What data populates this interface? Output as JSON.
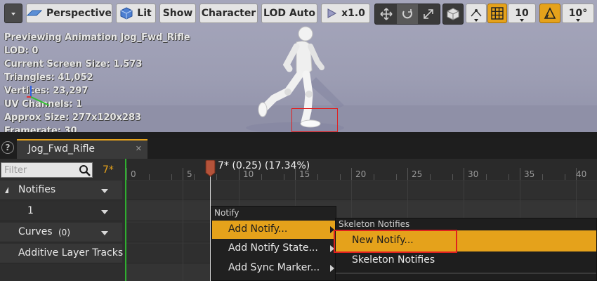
{
  "toolbar": {
    "perspective_label": "Perspective",
    "lit_label": "Lit",
    "show_label": "Show",
    "character_label": "Character",
    "lod_label": "LOD Auto",
    "speed_label": "x1.0",
    "grid_snap_value": "10",
    "rotation_snap_value": "10°"
  },
  "stats": [
    "Previewing Animation Jog_Fwd_Rifle",
    "LOD: 0",
    "Current Screen Size: 1.573",
    "Triangles: 41,052",
    "Vertices: 23,297",
    "UV Channels: 1",
    "Approx Size: 277x120x283",
    "Framerate: 30"
  ],
  "tab": {
    "title": "Jog_Fwd_Rifle"
  },
  "left_panel": {
    "filter_placeholder": "Filter",
    "frame_indicator": "7*",
    "tracks": {
      "notifies": "Notifies",
      "notify_row": "1",
      "curves": "Curves",
      "curves_count": "(0)",
      "additive": "Additive Layer Tracks"
    }
  },
  "timeline": {
    "ruler_labels": [
      "0",
      "5",
      "10",
      "15",
      "20",
      "25",
      "30",
      "35",
      "40"
    ],
    "scrubber_text": "7* (0.25) (17.34%)"
  },
  "context_menu": {
    "header": "Notify",
    "items": [
      "Add Notify...",
      "Add Notify State...",
      "Add Sync Marker..."
    ]
  },
  "submenu": {
    "header": "Skeleton Notifies",
    "items": [
      "New Notify...",
      "Skeleton Notifies"
    ]
  },
  "colors": {
    "accent": "#e5a21b",
    "highlight_red": "#e02020",
    "timeline_start": "#2fae2f"
  }
}
